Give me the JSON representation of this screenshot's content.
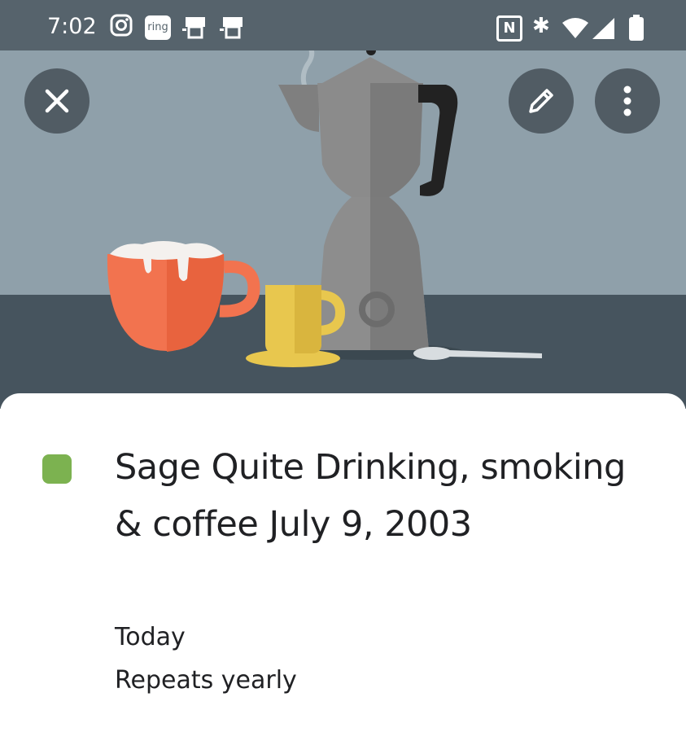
{
  "status_bar": {
    "time": "7:02",
    "left_icons": [
      "instagram-icon",
      "ring-icon",
      "cast-icon",
      "cast-icon"
    ],
    "ring_label": "ring",
    "right_icons": [
      "nfc-icon",
      "bluetooth-icon",
      "wifi-icon",
      "cellular-signal-icon",
      "battery-icon"
    ],
    "nfc_label": "N",
    "bluetooth_glyph": "✱"
  },
  "hero": {
    "illustration": "coffee-pot-illustration",
    "colors": {
      "wall": "#8fa0aa",
      "table": "#46545e",
      "red_cup": "#f2734f",
      "yellow_cup": "#e8c74e",
      "pot": "#8b8b8b"
    },
    "buttons": {
      "close": "close-icon",
      "edit": "edit-pencil-icon",
      "more": "more-vert-icon"
    }
  },
  "event": {
    "color": "#7cb250",
    "title": "Sage Quite Drinking, smoking & coffee July 9, 2003",
    "date": "Today",
    "repeat": "Repeats yearly"
  }
}
